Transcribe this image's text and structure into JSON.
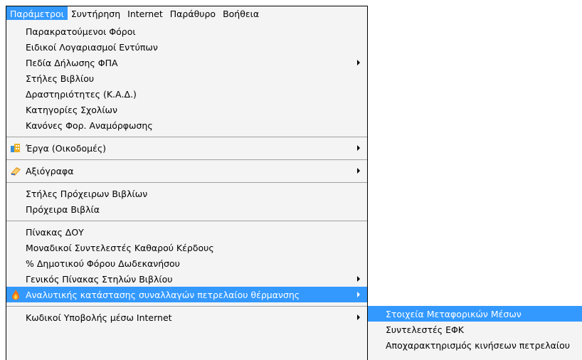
{
  "menubar": {
    "items": [
      "Παράμετροι",
      "Συντήρηση",
      "Internet",
      "Παράθυρο",
      "Βοήθεια"
    ]
  },
  "menu": {
    "group1": [
      "Παρακρατούμενοι Φόροι",
      "Ειδικοί Λογαριασμοί Εντύπων",
      "Πεδία Δήλωσης ΦΠΑ",
      "Στήλες Βιβλίου",
      "Δραστηριότητες (Κ.Α.Δ.)",
      "Κατηγορίες Σχολίων",
      "Κανόνες Φορ. Αναμόρφωσης"
    ],
    "erga": "Έργα (Οικοδομές)",
    "axiografa": "Αξιόγραφα",
    "group4": [
      "Στήλες Πρόχειρων Βιβλίων",
      "Πρόχειρα Βιβλία"
    ],
    "group5": [
      "Πίνακας ΔΟΥ",
      "Μοναδικοί Συντελεστές Καθαρού Κέρδους",
      "% Δημοτικού Φόρου Δωδεκανήσου",
      "Γενικός Πίνακας Στηλών Βιβλίου",
      "Αναλυτικής κατάστασης συναλλαγών πετρελαίου θέρμανσης"
    ],
    "internet_codes": "Κωδικοί Υποβολής μέσω Internet"
  },
  "submenu": {
    "items": [
      "Στοιχεία Μεταφορικών Μέσων",
      "Συντελεστές ΕΦΚ",
      "Αποχαρακτηρισμός κινήσεων πετρελαίου"
    ]
  },
  "colors": {
    "highlight": "#3399ff",
    "menu_bg": "#f4f4f4"
  }
}
